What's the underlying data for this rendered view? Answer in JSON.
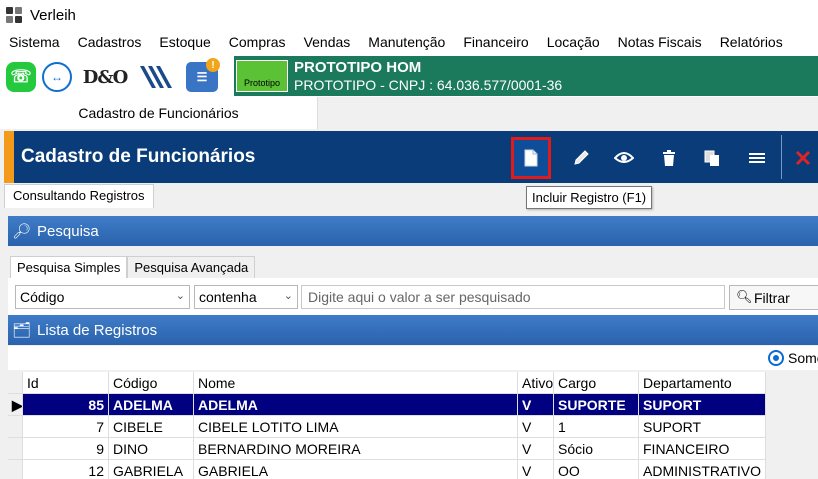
{
  "window": {
    "title": "Verleih"
  },
  "menu": [
    "Sistema",
    "Cadastros",
    "Estoque",
    "Compras",
    "Vendas",
    "Manutenção",
    "Financeiro",
    "Locação",
    "Notas Fiscais",
    "Relatórios"
  ],
  "quickbar": {
    "icons": [
      "whatsapp-icon",
      "teamviewer-icon",
      "dno-logo",
      "stripes-logo",
      "info-icon"
    ],
    "dno_text": "D&O",
    "info_badge": "!"
  },
  "company": {
    "logo_text": "Prototipo",
    "name": "PROTOTIPO HOM",
    "cnpj": "PROTOTIPO - CNPJ : 64.036.577/0001-36",
    "color": "#1c7a5c"
  },
  "doc_tab": "Cadastro de Funcionários",
  "header": {
    "title": "Cadastro de Funcionários",
    "color": "#0b3c7a",
    "accent": "#f39a1b",
    "tooltip": "Incluir Registro (F1)"
  },
  "sub_tab": "Consultando Registros",
  "search_panel": {
    "title": "Pesquisa"
  },
  "search_tabs": [
    "Pesquisa Simples",
    "Pesquisa Avançada"
  ],
  "search": {
    "field": "Código",
    "operator": "contenha",
    "placeholder": "Digite aqui o valor a ser pesquisado",
    "filter_label": "Filtrar"
  },
  "list_panel": {
    "title": "Lista de Registros"
  },
  "options": {
    "radio_label": "Some"
  },
  "table": {
    "columns": [
      "Id",
      "Código",
      "Nome",
      "Ativo",
      "Cargo",
      "Departamento"
    ],
    "rows": [
      {
        "id": "85",
        "codigo": "ADELMA",
        "nome": "ADELMA",
        "ativo": "V",
        "cargo": "SUPORTE",
        "departamento": "SUPORT"
      },
      {
        "id": "7",
        "codigo": "CIBELE",
        "nome": "CIBELE LOTITO LIMA",
        "ativo": "V",
        "cargo": "1",
        "departamento": "SUPORT"
      },
      {
        "id": "9",
        "codigo": "DINO",
        "nome": "BERNARDINO MOREIRA",
        "ativo": "V",
        "cargo": "Sócio",
        "departamento": "FINANCEIRO"
      },
      {
        "id": "12",
        "codigo": "GABRIELA",
        "nome": "GABRIELA",
        "ativo": "V",
        "cargo": "OO",
        "departamento": "ADMINISTRATIVO"
      }
    ]
  }
}
